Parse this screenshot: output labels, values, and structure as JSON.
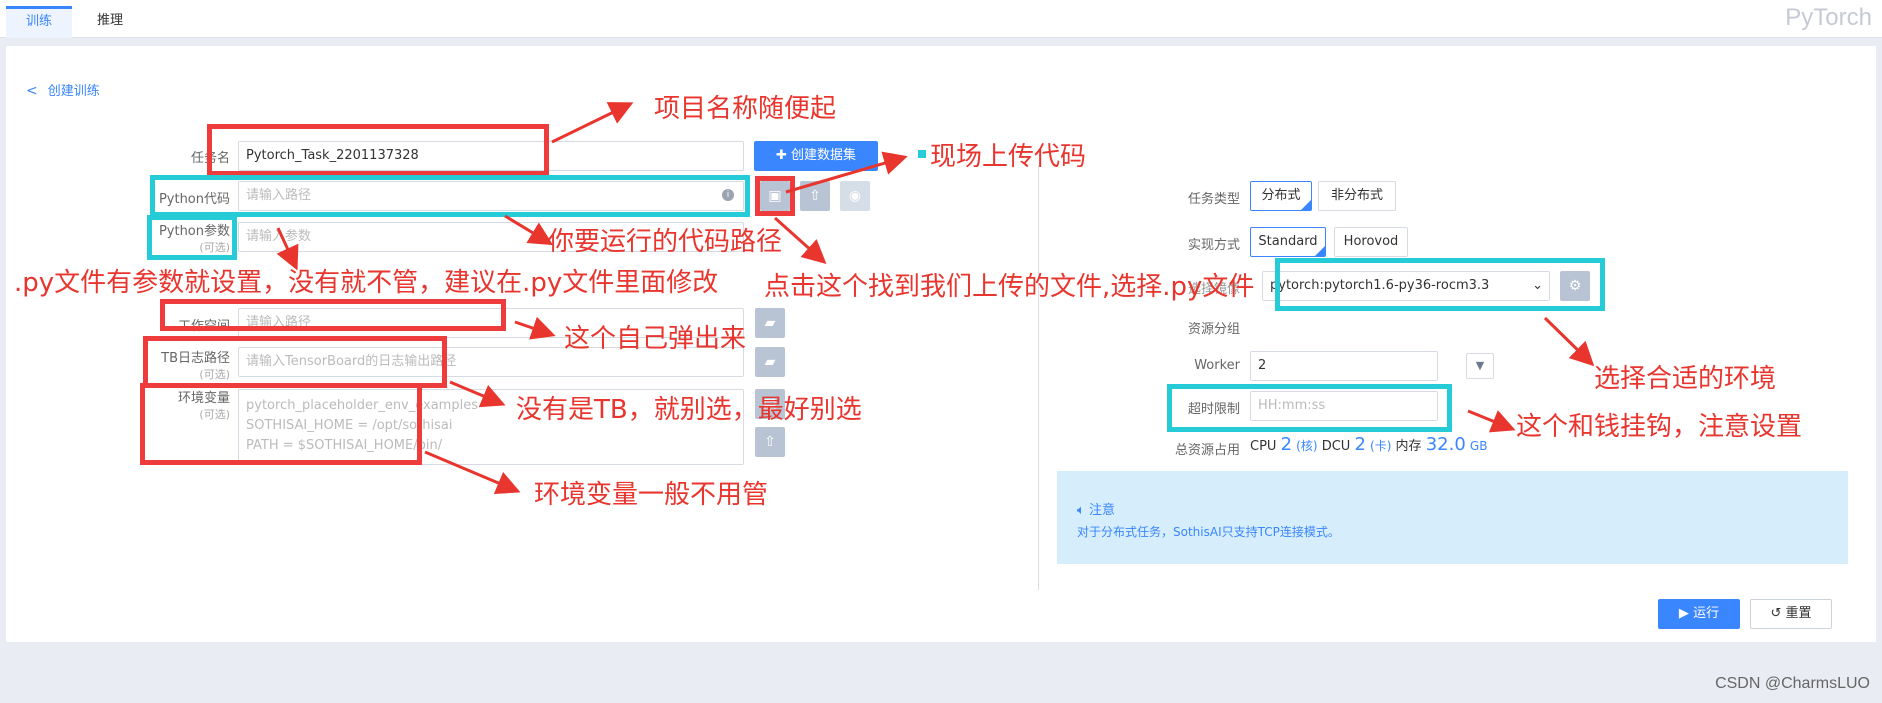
{
  "tabs": [
    {
      "label": "训练"
    },
    {
      "label": "推理"
    }
  ],
  "brand": "PyTorch",
  "back_link": "创建训练",
  "form": {
    "task_name": {
      "label": "任务名",
      "value": "Pytorch_Task_2201137328"
    },
    "create_dataset": "创建数据集",
    "python_code": {
      "label": "Python代码",
      "placeholder": "请输入路径"
    },
    "python_args": {
      "label": "Python参数",
      "optional": "(可选)",
      "placeholder": "请输入参数"
    },
    "workspace": {
      "label": "工作空间",
      "placeholder": "请输入路径"
    },
    "tb_log": {
      "label": "TB日志路径",
      "optional": "(可选)",
      "placeholder": "请输入TensorBoard的日志输出路径"
    },
    "env_vars": {
      "label": "环境变量",
      "optional": "(可选)",
      "lines": [
        "pytorch_placeholder_env_examples",
        "SOTHISAI_HOME = /opt/sothisai",
        "PATH = $SOTHISAI_HOME/bin/"
      ]
    }
  },
  "right": {
    "task_type": {
      "label": "任务类型",
      "options": [
        "分布式",
        "非分布式"
      ]
    },
    "impl": {
      "label": "实现方式",
      "options": [
        "Standard",
        "Horovod"
      ]
    },
    "image": {
      "label": "选择镜像",
      "value": "pytorch:pytorch1.6-py36-rocm3.3"
    },
    "resource_group": {
      "label": "资源分组"
    },
    "worker": {
      "label": "Worker",
      "value": "2"
    },
    "timeout": {
      "label": "超时限制",
      "placeholder": "HH:mm:ss"
    },
    "total": {
      "label": "总资源占用",
      "cpu_label": "CPU",
      "cpu": "2",
      "cpu_unit": "(核)",
      "dcu_label": "DCU",
      "dcu": "2",
      "dcu_unit": "(卡)",
      "mem_label": "内存",
      "mem": "32.0",
      "mem_unit": "GB"
    }
  },
  "notice": {
    "title": "注意",
    "text": "对于分布式任务，SothisAI只支持TCP连接模式。"
  },
  "actions": {
    "run": "运行",
    "reset": "重置"
  },
  "footer": "CSDN @CharmsLUO",
  "annotations": {
    "a1": "项目名称随便起",
    "a2": "现场上传代码",
    "a3": "你要运行的代码路径",
    "a4": ".py文件有参数就设置，没有就不管，建议在.py文件里面修改",
    "a5": "点击这个找到我们上传的文件,选择.py文件",
    "a6": "这个自己弹出来",
    "a7": "没有是TB，就别选，最好别选",
    "a8": "环境变量一般不用管",
    "a9": "选择合适的环境",
    "a10": "这个和钱挂钩，注意设置"
  },
  "colors": {
    "accent": "#3a86ff",
    "annotation_red": "#e8352e",
    "annotation_cyan": "#25ccd8",
    "notice_bg": "#d6edfb"
  }
}
